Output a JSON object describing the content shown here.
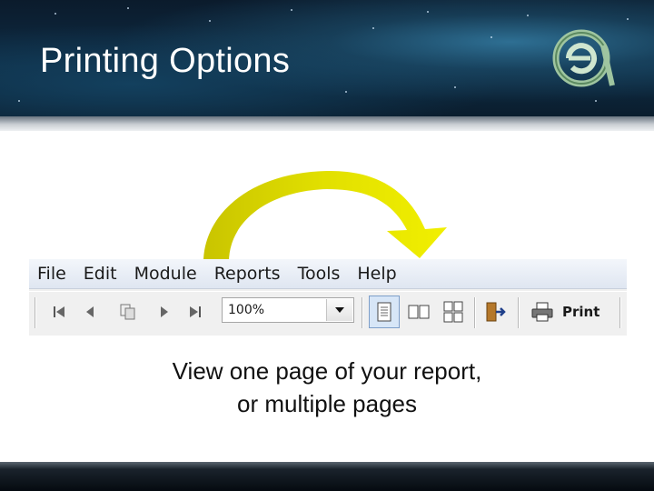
{
  "slide": {
    "title": "Printing Options",
    "caption_line1": "View one page of your report,",
    "caption_line2": "or multiple pages"
  },
  "menu": {
    "items": [
      "File",
      "Edit",
      "Module",
      "Reports",
      "Tools",
      "Help"
    ]
  },
  "toolbar": {
    "zoom_value": "100%",
    "print_label": "Print",
    "icons": [
      "first-page-icon",
      "previous-page-icon",
      "copy-pages-icon",
      "next-page-icon",
      "last-page-icon",
      "single-page-icon",
      "two-pages-icon",
      "four-pages-icon",
      "exit-icon",
      "printer-icon"
    ]
  },
  "colors": {
    "arrow_yellow": "#e8e600",
    "arrow_dark": "#c9c400",
    "header_dark": "#0b1b2c",
    "logo_green": "#6fa06a"
  }
}
